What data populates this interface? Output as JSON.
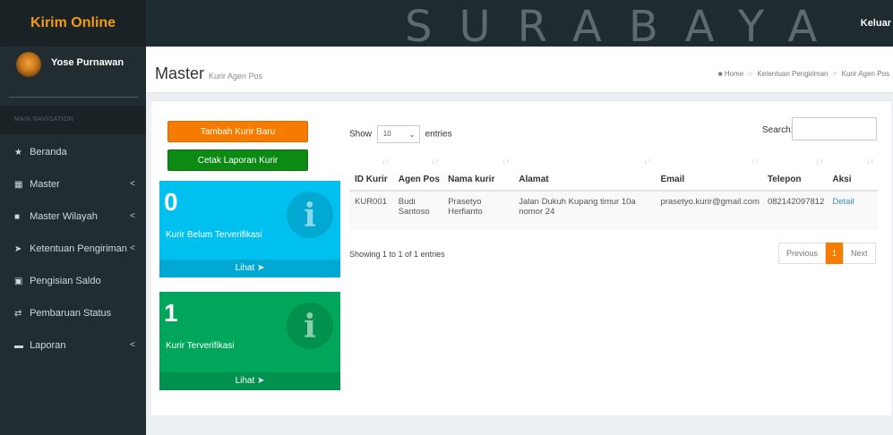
{
  "app": {
    "title": "Kirim Online",
    "watermark": "SURABAYA",
    "logout": "Keluar"
  },
  "user": {
    "name": "Yose Purnawan"
  },
  "sidebar": {
    "header": "MAIN NAVIGATION",
    "items": [
      {
        "label": "Beranda",
        "icon": "home-icon",
        "glyph": "★",
        "has_submenu": false
      },
      {
        "label": "Master",
        "icon": "grid-icon",
        "glyph": "▦",
        "has_submenu": true
      },
      {
        "label": "Master Wilayah",
        "icon": "map-icon",
        "glyph": "■",
        "has_submenu": true
      },
      {
        "label": "Ketentuan Pengiriman",
        "icon": "send-icon",
        "glyph": "➤",
        "has_submenu": true
      },
      {
        "label": "Pengisian Saldo",
        "icon": "wallet-icon",
        "glyph": "▣",
        "has_submenu": false
      },
      {
        "label": "Pembaruan Status",
        "icon": "exchange-icon",
        "glyph": "⇄",
        "has_submenu": false
      },
      {
        "label": "Laporan",
        "icon": "folder-icon",
        "glyph": "▬",
        "has_submenu": true
      }
    ],
    "chevron": "<"
  },
  "header": {
    "title": "Master",
    "subtitle": "Kurir Agen Pos",
    "breadcrumb": [
      "Home",
      "Ketentuan Pengiriman",
      "Kurir Agen Pos"
    ]
  },
  "buttons": {
    "add": "Tambah Kurir Baru",
    "print": "Cetak Laporan Kurir"
  },
  "boxes": [
    {
      "count": "0",
      "label": "Kurir Belum Terverifikasi",
      "footer": "Lihat",
      "color": "#00c0ef"
    },
    {
      "count": "1",
      "label": "Kurir Terverifikasi",
      "footer": "Lihat",
      "color": "#00a65a"
    }
  ],
  "datatable": {
    "show_label": "Show",
    "length": "10",
    "entries_label": "entries",
    "search_label": "Search:",
    "search_value": "",
    "columns": [
      "ID Kurir",
      "Agen Pos",
      "Nama kurir",
      "Alamat",
      "Email",
      "Telepon",
      "Aksi"
    ],
    "rows": [
      {
        "id": "KUR001",
        "agen": "Budi Santoso",
        "nama": "Prasetyo Herfianto",
        "alamat": "Jalan Dukuh Kupang timur 10a nomor 24",
        "email": "prasetyo.kurir@gmail.com",
        "telepon": "082142097812",
        "aksi": "Detail"
      }
    ],
    "info": "Showing 1 to 1 of 1 entries",
    "pagination": {
      "previous": "Previous",
      "current": "1",
      "next": "Next"
    }
  },
  "colors": {
    "accent_orange": "#f57c00",
    "print_green": "#0d8a14",
    "sidebar": "#222d32",
    "logo": "#f39c12"
  }
}
